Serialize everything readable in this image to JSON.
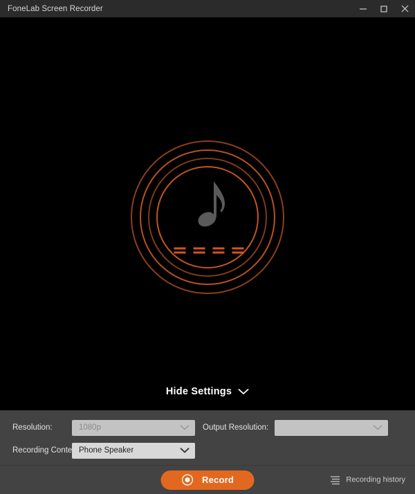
{
  "window": {
    "title": "FoneLab Screen Recorder",
    "controls": [
      {
        "name": "minimize",
        "glyph": "minimize-icon"
      },
      {
        "name": "maximize",
        "glyph": "maximize-icon"
      },
      {
        "name": "close",
        "glyph": "close-icon"
      }
    ],
    "titlebar_bg": "#2b2b2b"
  },
  "preview": {
    "background": "#000000",
    "visualizer": {
      "icon": "music-note-icon",
      "note_color": "#5a5a5a",
      "ring_colors": [
        "#8c3f1c",
        "#b8521f",
        "#7d3a1b",
        "#c0561f"
      ],
      "ring_count": 4,
      "bar_color": "#d4551f",
      "bar_groups": 4,
      "bars_per_group": 2
    }
  },
  "settings_toggle": {
    "label": "Hide Settings",
    "icon": "chevron-down-icon"
  },
  "settings": {
    "panel_bg": "#434343",
    "rows": [
      {
        "label": "Resolution:",
        "value": "1080p",
        "placeholder": "",
        "disabled": true,
        "icon": "chevron-down-icon"
      },
      {
        "label": "Output Resolution:",
        "value": "",
        "placeholder": "",
        "disabled": true,
        "icon": "chevron-down-icon"
      },
      {
        "label": "Recording Content:",
        "value": "Phone Speaker",
        "placeholder": "",
        "disabled": false,
        "icon": "chevron-down-icon"
      }
    ]
  },
  "bottombar": {
    "bg": "#434343",
    "record": {
      "label": "Record",
      "icon": "record-dot-icon",
      "color": "#e2681f"
    },
    "history": {
      "label": "Recording history",
      "icon": "list-menu-icon"
    }
  }
}
